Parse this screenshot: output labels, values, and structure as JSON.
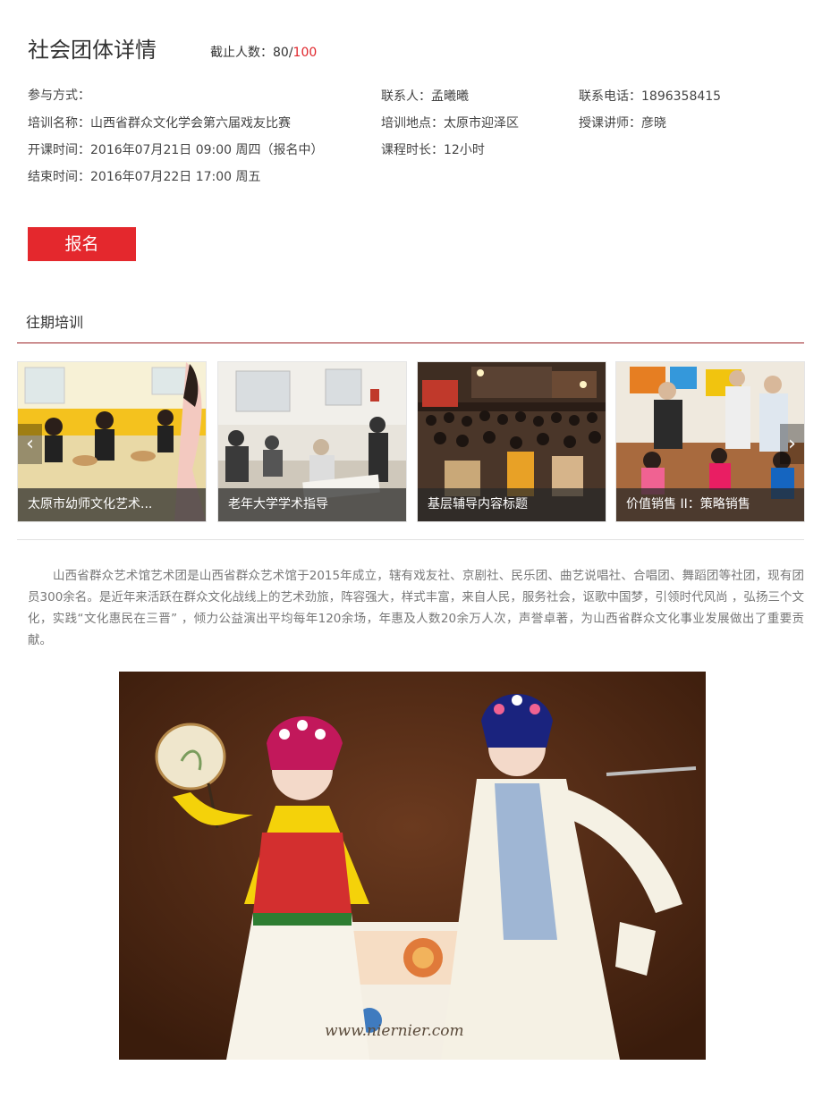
{
  "header": {
    "title": "社会团体详情",
    "capacity_label": "截止人数：80/",
    "capacity_max": "100"
  },
  "info": {
    "participation": "参与方式：",
    "training_name": "培训名称：山西省群众文化学会第六届戏友比赛",
    "start_time": "开课时间：2016年07月21日 09:00 周四（报名中）",
    "end_time": "结束时间：2016年07月22日 17:00 周五",
    "contact_person": "联系人：孟曦曦",
    "location": "培训地点：太原市迎泽区",
    "duration": "课程时长：12小时",
    "phone": "联系电话：1896358415",
    "instructor": "授课讲师：彦晓"
  },
  "actions": {
    "signup_label": "报名"
  },
  "past_training": {
    "title": "往期培训",
    "cards": [
      {
        "caption": "太原市幼师文化艺术..."
      },
      {
        "caption": "老年大学学术指导"
      },
      {
        "caption": "基层辅导内容标题"
      },
      {
        "caption": "价值销售 II：策略销售"
      }
    ],
    "prev_icon": "chevron-left-icon",
    "next_icon": "chevron-right-icon"
  },
  "description": "山西省群众艺术馆艺术团是山西省群众艺术馆于2015年成立，辖有戏友社、京剧社、民乐团、曲艺说唱社、合唱团、舞蹈团等社团，现有团员300余名。是近年来活跃在群众文化战线上的艺术劲旅，阵容强大，样式丰富，来自人民，服务社会，讴歌中国梦，引领时代风尚 ，弘扬三个文化，实践“文化惠民在三晋” ，倾力公益演出平均每年120余场，年惠及人数20余万人次，声誉卓著，为山西省群众文化事业发展做出了重要贡献。",
  "hero": {
    "watermark": "www.niernier.com"
  },
  "colors": {
    "accent_red": "#e4282d",
    "rule_red": "#9b2226"
  }
}
